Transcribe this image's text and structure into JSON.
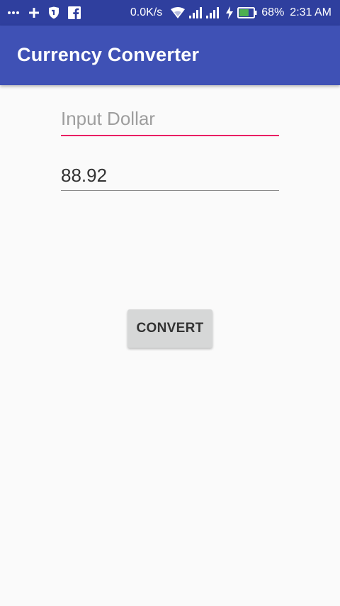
{
  "status_bar": {
    "left_icons": [
      "more-dots-icon",
      "plus-icon",
      "shield-icon",
      "facebook-icon"
    ],
    "network_speed": "0.0K/s",
    "right_icons": [
      "wifi-icon",
      "signal-icon",
      "signal-icon",
      "charging-icon",
      "battery-icon"
    ],
    "battery_percent": "68%",
    "time": "2:31 AM",
    "battery_level": 0.68,
    "battery_color": "#4caf50"
  },
  "app_bar": {
    "title": "Currency Converter",
    "color": "#3f51b5"
  },
  "dollar_input": {
    "placeholder": "Input Dollar",
    "value": "",
    "accent_color": "#e91e63"
  },
  "result": {
    "value": "88.92"
  },
  "convert_button": {
    "label": "CONVERT"
  }
}
